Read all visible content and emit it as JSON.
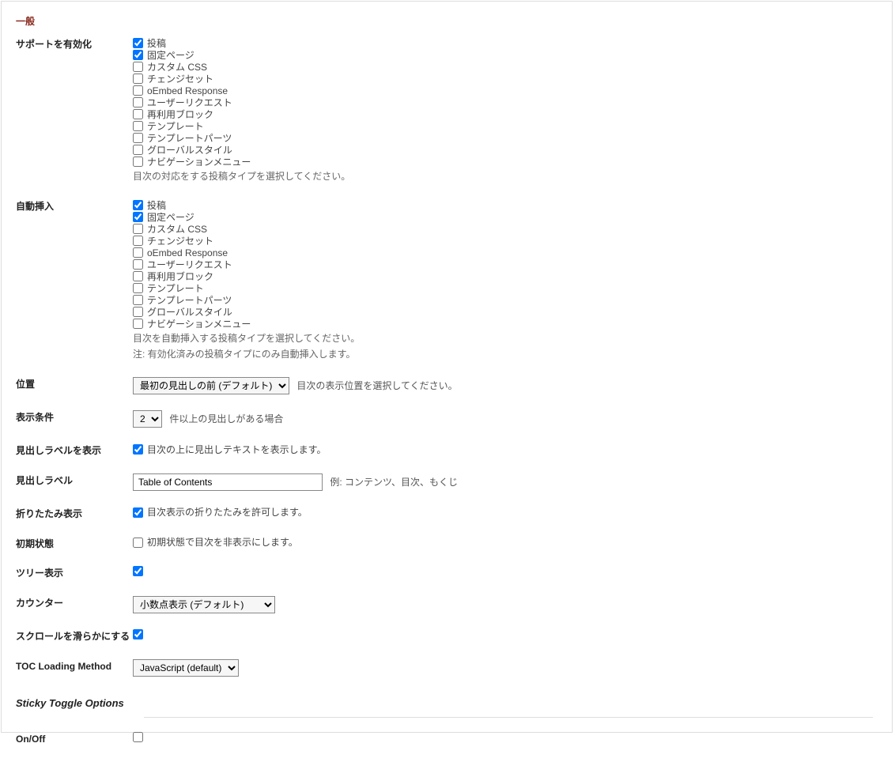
{
  "section_title": "一般",
  "sticky_section_title": "Sticky Toggle Options",
  "post_types": [
    "投稿",
    "固定ページ",
    "カスタム CSS",
    "チェンジセット",
    "oEmbed Response",
    "ユーザーリクエスト",
    "再利用ブロック",
    "テンプレート",
    "テンプレートパーツ",
    "グローバルスタイル",
    "ナビゲーションメニュー"
  ],
  "rows": {
    "enable_support": {
      "label": "サポートを有効化",
      "checked": [
        true,
        true,
        false,
        false,
        false,
        false,
        false,
        false,
        false,
        false,
        false
      ],
      "desc": "目次の対応をする投稿タイプを選択してください。"
    },
    "auto_insert": {
      "label": "自動挿入",
      "checked": [
        true,
        true,
        false,
        false,
        false,
        false,
        false,
        false,
        false,
        false,
        false
      ],
      "desc1": "目次を自動挿入する投稿タイプを選択してください。",
      "desc2": "注: 有効化済みの投稿タイプにのみ自動挿入します。"
    },
    "position": {
      "label": "位置",
      "selected": "最初の見出しの前 (デフォルト)",
      "desc": "目次の表示位置を選択してください。"
    },
    "show_condition": {
      "label": "表示条件",
      "selected": "2",
      "after_text": "件以上の見出しがある場合"
    },
    "show_heading_label": {
      "label": "見出しラベルを表示",
      "checked": true,
      "text": "目次の上に見出しテキストを表示します。"
    },
    "heading_label": {
      "label": "見出しラベル",
      "value": "Table of Contents",
      "example": "例: コンテンツ、目次、もくじ"
    },
    "collapsible": {
      "label": "折りたたみ表示",
      "checked": true,
      "text": "目次表示の折りたたみを許可します。"
    },
    "initial_state": {
      "label": "初期状態",
      "checked": false,
      "text": "初期状態で目次を非表示にします。"
    },
    "tree_view": {
      "label": "ツリー表示",
      "checked": true
    },
    "counter": {
      "label": "カウンター",
      "selected": "小数点表示 (デフォルト)"
    },
    "smooth_scroll": {
      "label": "スクロールを滑らかにする",
      "checked": true
    },
    "toc_loading": {
      "label": "TOC Loading Method",
      "selected": "JavaScript (default)"
    },
    "sticky_onoff": {
      "label": "On/Off",
      "checked": false
    }
  }
}
